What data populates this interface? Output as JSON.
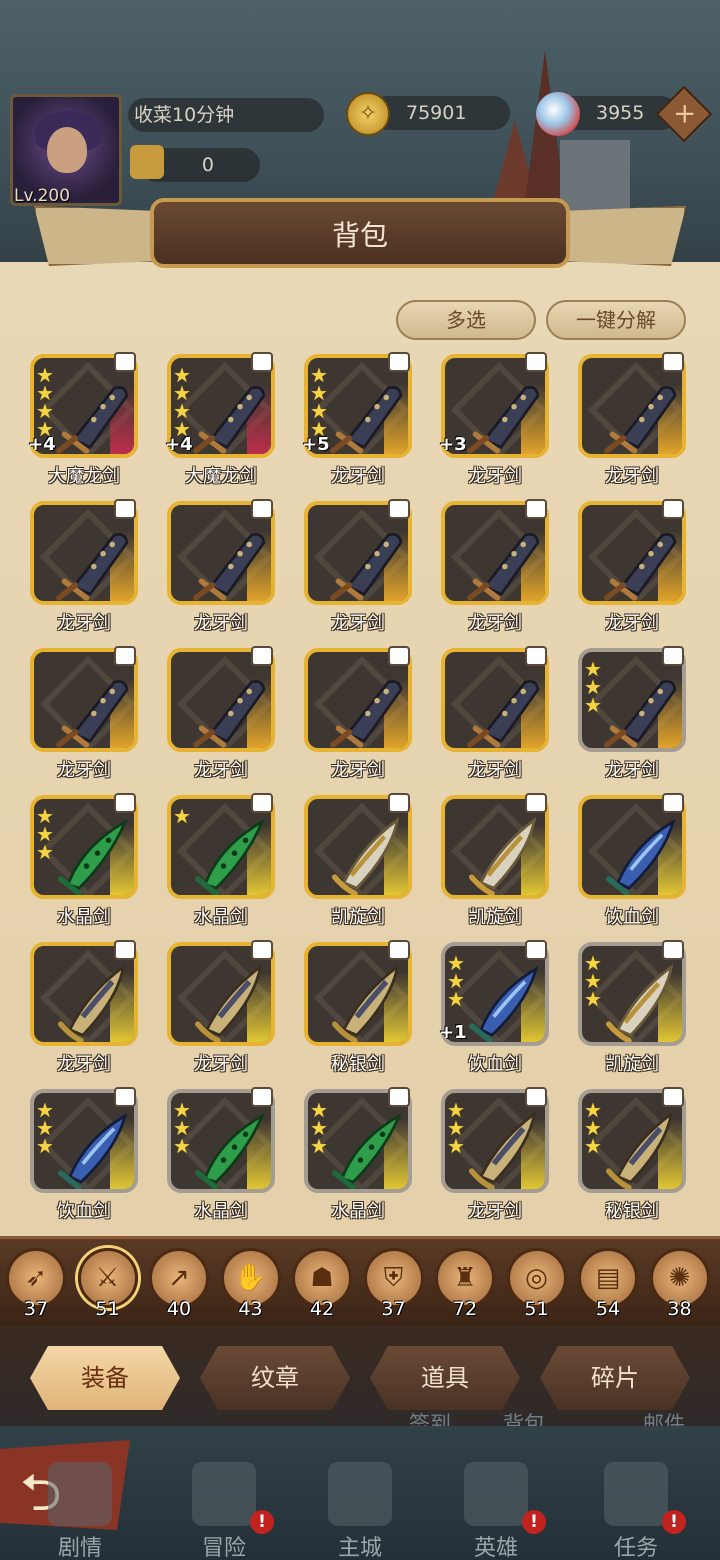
{
  "player": {
    "level": "Lv.200",
    "status": "收菜10分钟",
    "power": "0"
  },
  "currency": {
    "gold": "75901",
    "gems": "3955"
  },
  "panel": {
    "title": "背包",
    "multi_select": "多选",
    "decompose_all": "一键分解"
  },
  "items": [
    {
      "name": "大魔龙剑",
      "stars": 4,
      "plus": "+4",
      "rarity": "red",
      "weapon": "club"
    },
    {
      "name": "大魔龙剑",
      "stars": 4,
      "plus": "+4",
      "rarity": "red",
      "weapon": "club"
    },
    {
      "name": "龙牙剑",
      "stars": 4,
      "plus": "+5",
      "rarity": "orange",
      "weapon": "club"
    },
    {
      "name": "龙牙剑",
      "stars": 0,
      "plus": "+3",
      "rarity": "orange",
      "weapon": "club"
    },
    {
      "name": "龙牙剑",
      "stars": 0,
      "plus": "",
      "rarity": "orange",
      "weapon": "club"
    },
    {
      "name": "龙牙剑",
      "stars": 0,
      "plus": "",
      "rarity": "orange",
      "weapon": "club"
    },
    {
      "name": "龙牙剑",
      "stars": 0,
      "plus": "",
      "rarity": "orange",
      "weapon": "club"
    },
    {
      "name": "龙牙剑",
      "stars": 0,
      "plus": "",
      "rarity": "orange",
      "weapon": "club"
    },
    {
      "name": "龙牙剑",
      "stars": 0,
      "plus": "",
      "rarity": "orange",
      "weapon": "club"
    },
    {
      "name": "龙牙剑",
      "stars": 0,
      "plus": "",
      "rarity": "orange",
      "weapon": "club"
    },
    {
      "name": "龙牙剑",
      "stars": 0,
      "plus": "",
      "rarity": "orange",
      "weapon": "club"
    },
    {
      "name": "龙牙剑",
      "stars": 0,
      "plus": "",
      "rarity": "orange",
      "weapon": "club"
    },
    {
      "name": "龙牙剑",
      "stars": 0,
      "plus": "",
      "rarity": "orange",
      "weapon": "club"
    },
    {
      "name": "龙牙剑",
      "stars": 0,
      "plus": "",
      "rarity": "orange",
      "weapon": "club"
    },
    {
      "name": "龙牙剑",
      "stars": 3,
      "plus": "",
      "rarity": "orange",
      "weapon": "club",
      "silver": true
    },
    {
      "name": "水晶剑",
      "stars": 3,
      "plus": "",
      "rarity": "yellow",
      "weapon": "green"
    },
    {
      "name": "水晶剑",
      "stars": 1,
      "plus": "",
      "rarity": "yellow",
      "weapon": "green"
    },
    {
      "name": "凯旋剑",
      "stars": 0,
      "plus": "",
      "rarity": "yellow",
      "weapon": "gold"
    },
    {
      "name": "凯旋剑",
      "stars": 0,
      "plus": "",
      "rarity": "yellow",
      "weapon": "gold"
    },
    {
      "name": "饮血剑",
      "stars": 0,
      "plus": "",
      "rarity": "yellow",
      "weapon": "blue"
    },
    {
      "name": "龙牙剑",
      "stars": 0,
      "plus": "",
      "rarity": "yellow",
      "weapon": "saber"
    },
    {
      "name": "龙牙剑",
      "stars": 0,
      "plus": "",
      "rarity": "yellow",
      "weapon": "saber"
    },
    {
      "name": "秘银剑",
      "stars": 0,
      "plus": "",
      "rarity": "yellow",
      "weapon": "saber"
    },
    {
      "name": "饮血剑",
      "stars": 3,
      "plus": "+1",
      "rarity": "yellow",
      "weapon": "blue",
      "silver": true
    },
    {
      "name": "凯旋剑",
      "stars": 3,
      "plus": "",
      "rarity": "yellow",
      "weapon": "gold",
      "silver": true
    },
    {
      "name": "饮血剑",
      "stars": 3,
      "plus": "",
      "rarity": "yellow",
      "weapon": "blue",
      "silver": true
    },
    {
      "name": "水晶剑",
      "stars": 3,
      "plus": "",
      "rarity": "yellow",
      "weapon": "green",
      "silver": true
    },
    {
      "name": "水晶剑",
      "stars": 3,
      "plus": "",
      "rarity": "yellow",
      "weapon": "green",
      "silver": true
    },
    {
      "name": "龙牙剑",
      "stars": 3,
      "plus": "",
      "rarity": "yellow",
      "weapon": "saber",
      "silver": true
    },
    {
      "name": "秘银剑",
      "stars": 3,
      "plus": "",
      "rarity": "yellow",
      "weapon": "saber",
      "silver": true
    }
  ],
  "categories": [
    {
      "icon": "bow-icon",
      "glyph": "➶",
      "count": "37"
    },
    {
      "icon": "sword-icon",
      "glyph": "⚔",
      "count": "51",
      "selected": true
    },
    {
      "icon": "spear-icon",
      "glyph": "↗",
      "count": "40"
    },
    {
      "icon": "claw-icon",
      "glyph": "✋",
      "count": "43"
    },
    {
      "icon": "helmet-icon",
      "glyph": "☗",
      "count": "42"
    },
    {
      "icon": "shield-icon",
      "glyph": "⛨",
      "count": "37"
    },
    {
      "icon": "armor-icon",
      "glyph": "♜",
      "count": "72"
    },
    {
      "icon": "ring-icon",
      "glyph": "◎",
      "count": "51"
    },
    {
      "icon": "book-icon",
      "glyph": "▤",
      "count": "54"
    },
    {
      "icon": "amulet-icon",
      "glyph": "✺",
      "count": "38"
    }
  ],
  "tabs": [
    "装备",
    "纹章",
    "道具",
    "碎片"
  ],
  "behind_labels": [
    "签到",
    "背包",
    "邮件"
  ],
  "nav": [
    {
      "label": "剧情",
      "icon": "story-icon",
      "badge": ""
    },
    {
      "label": "冒险",
      "icon": "adventure-icon",
      "badge": "!"
    },
    {
      "label": "主城",
      "icon": "castle-icon",
      "badge": ""
    },
    {
      "label": "英雄",
      "icon": "hero-icon",
      "badge": "!"
    },
    {
      "label": "任务",
      "icon": "quest-icon",
      "badge": "!"
    }
  ],
  "colors": {
    "gold_frame": "#e7b332",
    "silver_frame": "#a59d92",
    "panel_bg": "#e9d8b6",
    "tab_selected": "#f3d7a6"
  }
}
